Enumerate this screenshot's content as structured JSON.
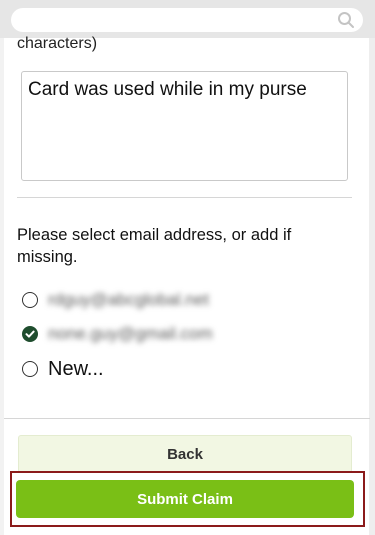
{
  "header": {
    "search_placeholder": "",
    "search_icon": "search-icon"
  },
  "claim_form": {
    "char_limit_hint": "characters)",
    "reason_text": "Card was used while in my purse",
    "email_prompt": "Please select email address, or add if missing.",
    "email_options": [
      {
        "label": "rdguy@abcglobal.net",
        "selected": false,
        "redacted": true
      },
      {
        "label": "none.guy@gmail.com",
        "selected": true,
        "redacted": true
      },
      {
        "label": "New...",
        "selected": false,
        "redacted": false
      }
    ]
  },
  "actions": {
    "back_label": "Back",
    "submit_label": "Submit Claim"
  },
  "colors": {
    "submit_bg": "#7abf16",
    "back_bg": "#f2f7e3",
    "highlight_border": "#8b1a1a",
    "radio_checked": "#1f4d2e"
  }
}
